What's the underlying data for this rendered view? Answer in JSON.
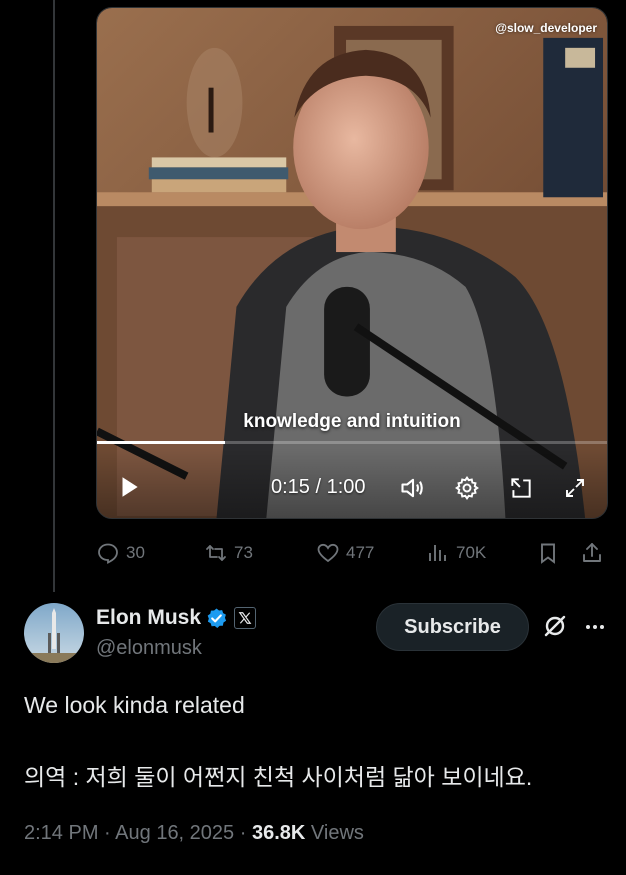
{
  "video": {
    "watermark": "@slow_developer",
    "caption": "knowledge and intuition",
    "time_display": "0:15 / 1:00",
    "progress_fraction": 0.25
  },
  "engagement": {
    "replies": "30",
    "reposts": "73",
    "likes": "477",
    "views": "70K"
  },
  "author": {
    "display_name": "Elon Musk",
    "handle": "@elonmusk",
    "verified_color": "#1d9bf0",
    "affiliate_icon": "x-logo-icon"
  },
  "subscribe_label": "Subscribe",
  "tweet": {
    "line1": "We look kinda related",
    "line2": "의역 : 저희 둘이 어쩐지 친척 사이처럼 닮아 보이네요."
  },
  "meta": {
    "time": "2:14 PM",
    "separator": "·",
    "date": "Aug 16, 2025",
    "views_count": "36.8K",
    "views_label": "Views"
  },
  "colors": {
    "background": "#000000",
    "text_primary": "#e7e9ea",
    "text_secondary": "#71767b",
    "accent": "#1d9bf0"
  }
}
